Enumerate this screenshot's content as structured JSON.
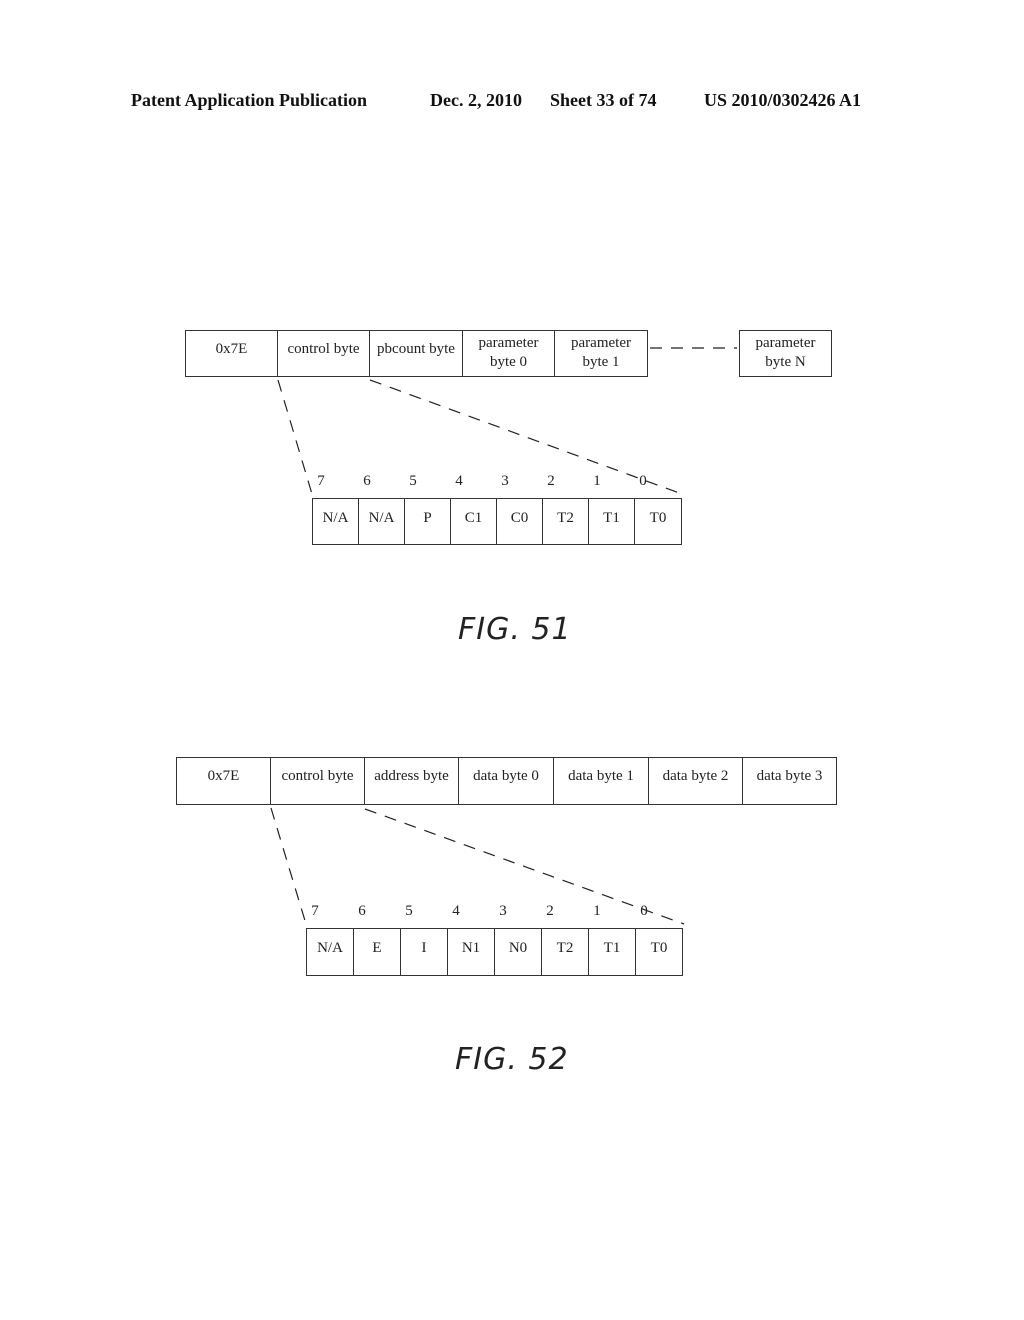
{
  "header": {
    "publication": "Patent Application Publication",
    "date": "Dec. 2, 2010",
    "sheet": "Sheet 33 of 74",
    "number": "US 2010/0302426 A1"
  },
  "fig51": {
    "label": "FIG. 51",
    "packet_fields": [
      "0x7E",
      "control byte",
      "pbcount byte",
      "parameter\nbyte 0",
      "parameter\nbyte 1"
    ],
    "last_field": "parameter\nbyte N",
    "bit_numbers": [
      "7",
      "6",
      "5",
      "4",
      "3",
      "2",
      "1",
      "0"
    ],
    "control_bits": [
      "N/A",
      "N/A",
      "P",
      "C1",
      "C0",
      "T2",
      "T1",
      "T0"
    ]
  },
  "fig52": {
    "label": "FIG. 52",
    "packet_fields": [
      "0x7E",
      "control byte",
      "address byte",
      "data byte 0",
      "data byte 1",
      "data byte 2",
      "data byte 3"
    ],
    "bit_numbers": [
      "7",
      "6",
      "5",
      "4",
      "3",
      "2",
      "1",
      "0"
    ],
    "control_bits": [
      "N/A",
      "E",
      "I",
      "N1",
      "N0",
      "T2",
      "T1",
      "T0"
    ]
  }
}
